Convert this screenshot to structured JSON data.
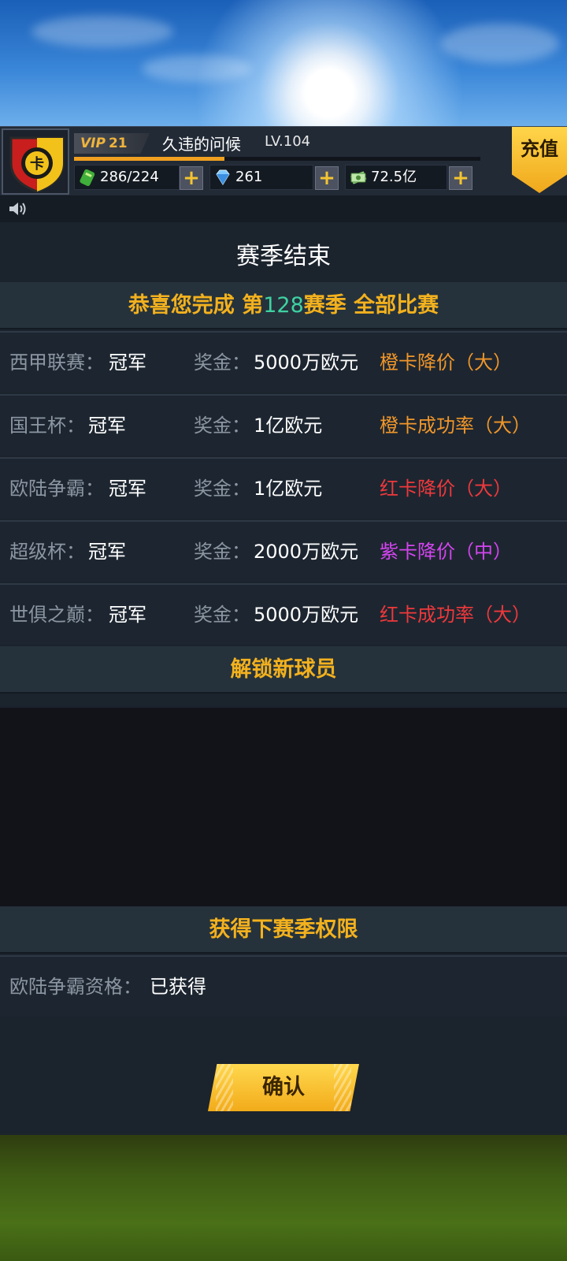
{
  "header": {
    "vip_prefix": "VIP",
    "vip_level": "21",
    "player_name": "久违的问候",
    "level": "LV.104",
    "exp_progress": 0.37,
    "stamina": "286/224",
    "diamonds": "261",
    "cash": "72.5亿",
    "recharge_label": "充值",
    "plus_label": "+"
  },
  "season": {
    "title": "赛季结束",
    "congrats_prefix": "恭喜您完成 第",
    "season_number": "128",
    "congrats_suffix": "赛季 全部比赛",
    "prize_label": "奖金：",
    "results": [
      {
        "competition": "西甲联赛：",
        "result": "冠军",
        "prize": "5000万欧元",
        "reward": "橙卡降价（大）",
        "reward_color": "#f1962a"
      },
      {
        "competition": "国王杯：",
        "result": "冠军",
        "prize": "1亿欧元",
        "reward": "橙卡成功率（大）",
        "reward_color": "#f1962a"
      },
      {
        "competition": "欧陆争霸：",
        "result": "冠军",
        "prize": "1亿欧元",
        "reward": "红卡降价（大）",
        "reward_color": "#f0383c"
      },
      {
        "competition": "超级杯：",
        "result": "冠军",
        "prize": "2000万欧元",
        "reward": "紫卡降价（中）",
        "reward_color": "#d444f0"
      },
      {
        "competition": "世俱之巅：",
        "result": "冠军",
        "prize": "5000万欧元",
        "reward": "红卡成功率（大）",
        "reward_color": "#f0383c"
      }
    ],
    "unlock_title": "解锁新球员",
    "next_title": "获得下赛季权限",
    "permission_label": "欧陆争霸资格：",
    "permission_value": "已获得",
    "confirm_label": "确认"
  },
  "colors": {
    "accent_gold": "#f3b11e",
    "season_number": "#3fd2a2"
  },
  "icons": [
    "club-crest-icon",
    "stamina-icon",
    "diamond-icon",
    "cash-icon",
    "speaker-icon"
  ]
}
